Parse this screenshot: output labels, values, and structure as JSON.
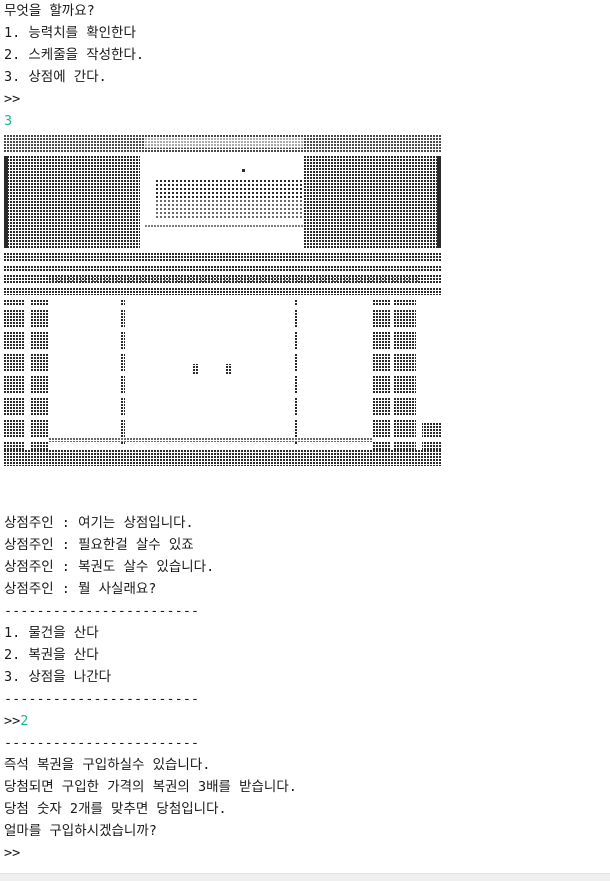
{
  "menu_prompt": {
    "question": "무엇을 할까요?",
    "options": [
      "1. 능력치를 확인한다",
      "2. 스케줄을 작성한다.",
      "3. 상점에 간다."
    ],
    "prompt": ">>",
    "entered": "3"
  },
  "shop_art": {
    "description_icon": "shop-building-ascii-art-icon",
    "color": "#2a2a2a"
  },
  "shopkeeper_dialog": [
    "상점주인 : 여기는 상점입니다.",
    "상점주인 : 필요한걸 살수 있죠",
    "상점주인 : 복권도 살수 있습니다.",
    "상점주인 : 뭘 사실래요?"
  ],
  "separator": "------------------------",
  "shop_menu": {
    "options": [
      "1. 물건을 산다",
      "2. 복권을 산다",
      "3. 상점을 나간다"
    ],
    "prompt": ">>",
    "entered": "2"
  },
  "lottery_info": [
    "즉석 복권을 구입하실수 있습니다.",
    "당첨되면 구입한 가격의 복권의 3배를 받습니다.",
    "당첨 숫자 2개를 맞추면 당첨입니다.",
    "얼마를 구입하시겠습니까?"
  ],
  "final_prompt": ">>",
  "colors": {
    "text": "#1a1a1a",
    "input_echo": "#17b890",
    "background": "#ffffff"
  }
}
